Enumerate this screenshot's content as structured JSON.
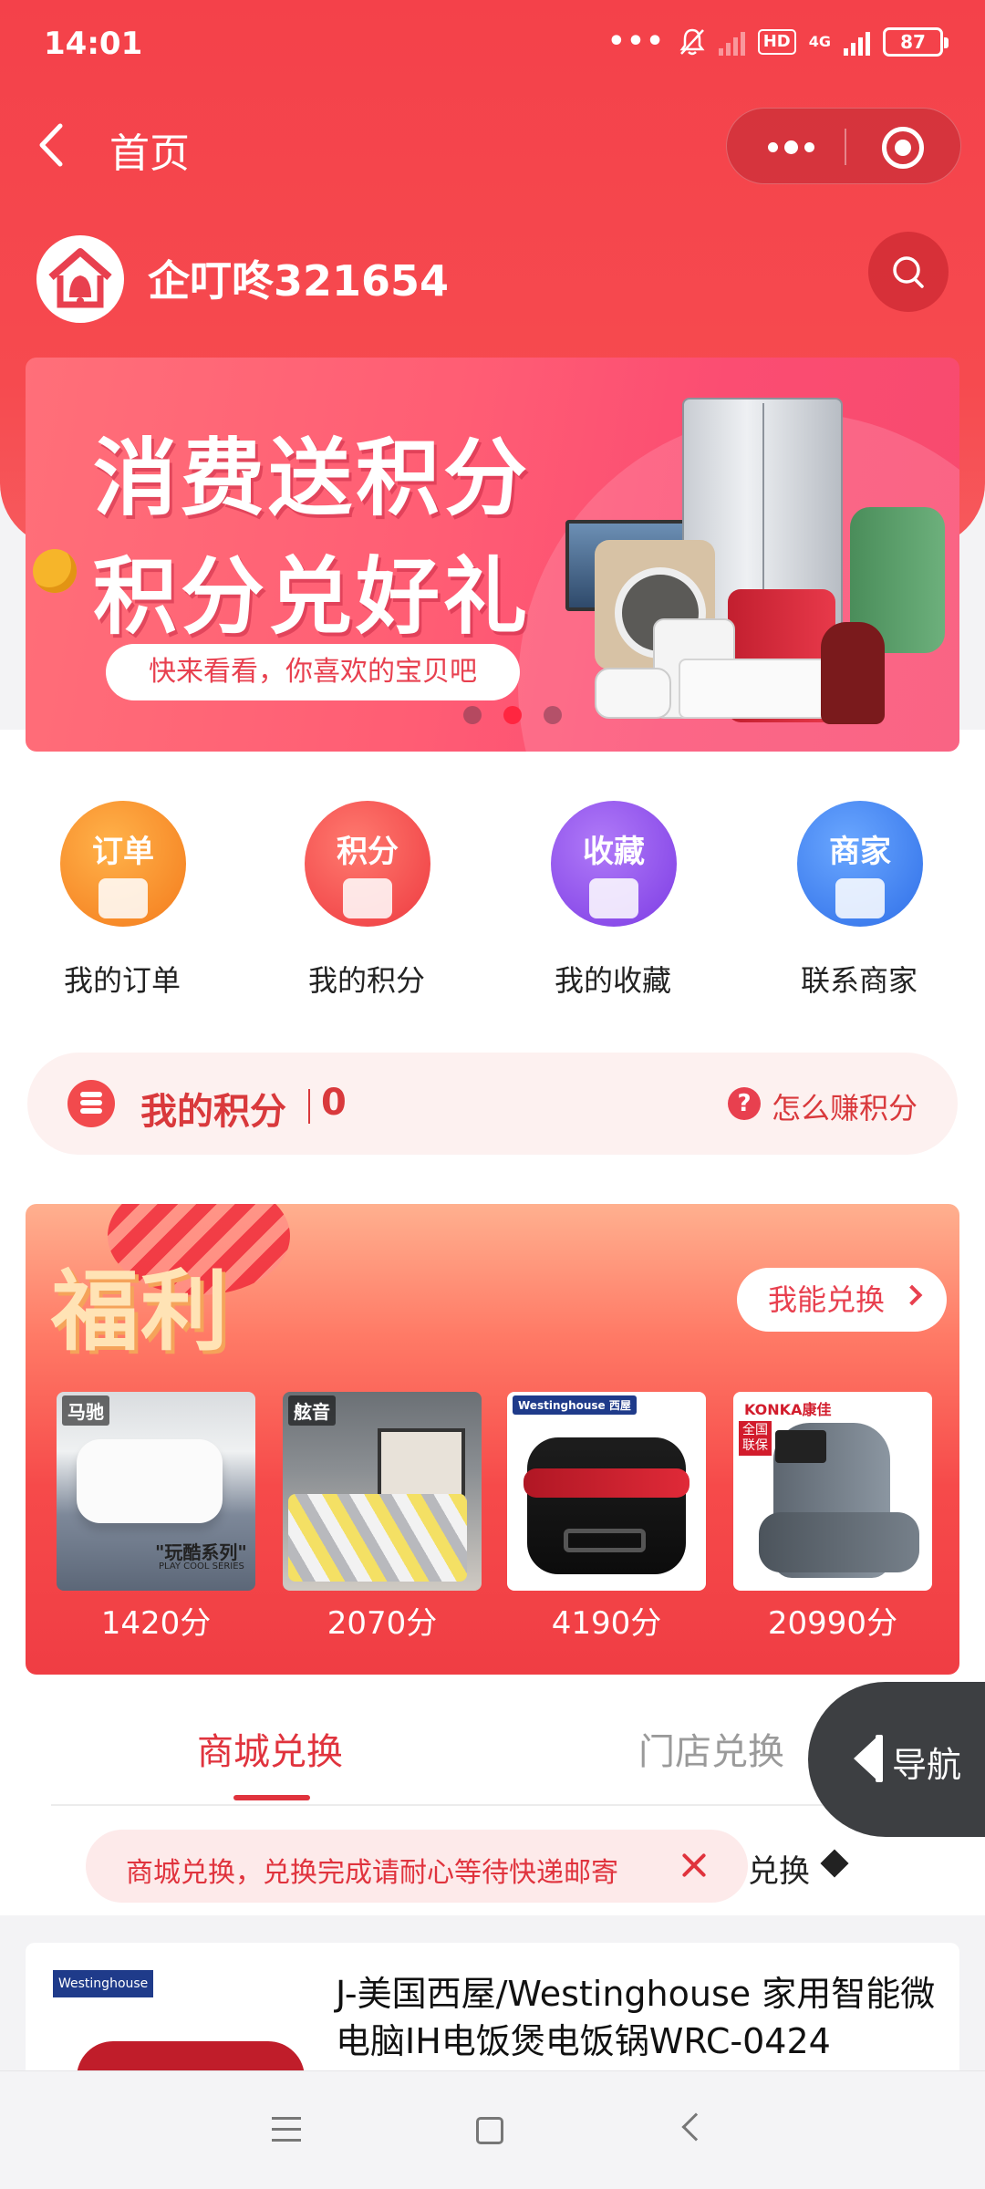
{
  "status_bar": {
    "time": "14:01",
    "dots": "•••",
    "hd": "HD",
    "network": "4G",
    "battery": "87"
  },
  "nav": {
    "title": "首页"
  },
  "store": {
    "name": "企叮咚321654"
  },
  "banner": {
    "line1": "消费送积分",
    "line2": "积分兑好礼",
    "pill": "快来看看，你喜欢的宝贝吧"
  },
  "quick_menu": [
    {
      "badge": "订单",
      "label": "我的订单",
      "color": "#f8872a"
    },
    {
      "badge": "积分",
      "label": "我的积分",
      "color": "#f2484e"
    },
    {
      "badge": "收藏",
      "label": "我的收藏",
      "color": "#8c4ee8"
    },
    {
      "badge": "商家",
      "label": "联系商家",
      "color": "#3f83f8"
    }
  ],
  "points": {
    "title": "我的积分",
    "value": "0",
    "help_icon": "?",
    "help": "怎么赚积分"
  },
  "welfare": {
    "title": "福利",
    "button": "我能兑换",
    "items": [
      {
        "brand": "马驰",
        "tag": "\"玩酷系列\"",
        "tag_sub": "PLAY COOL SERIES",
        "price": "1420分"
      },
      {
        "brand": "舷音",
        "price": "2070分"
      },
      {
        "brand": "Westinghouse 西屋",
        "price": "4190分"
      },
      {
        "brand": "KONKA康佳",
        "note_1": "全国",
        "note_2": "联保",
        "price": "20990分"
      }
    ]
  },
  "tabs": {
    "mall": "商城兑换",
    "store": "门店兑换"
  },
  "float_nav": {
    "label": "导航"
  },
  "tooltip": {
    "text": "商城兑换，兑换完成请耐心等待快递邮寄",
    "sub_tab": "兑换"
  },
  "product": {
    "logo": "Westinghouse 西屋",
    "title": "J-美国西屋/Westinghouse 家用智能微电脑IH电饭煲电饭锅WRC-0424"
  }
}
